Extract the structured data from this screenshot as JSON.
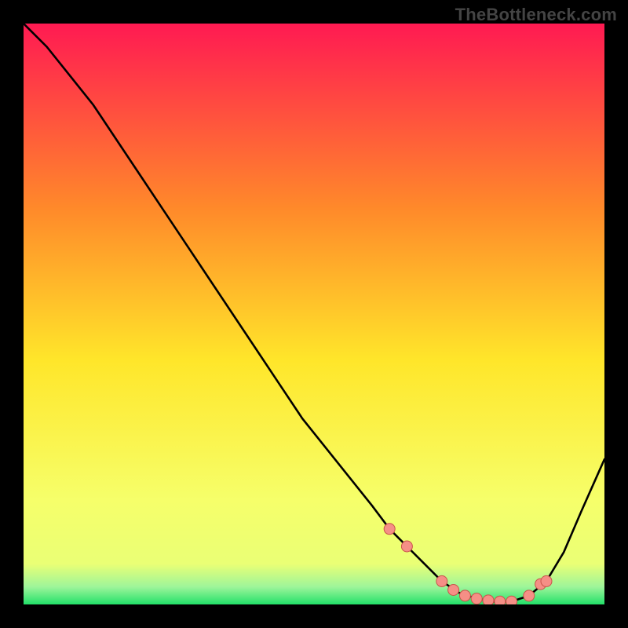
{
  "watermark": "TheBottleneck.com",
  "colors": {
    "bg_black": "#000000",
    "grad_top": "#ff1a52",
    "grad_mid_upper": "#ff8a2a",
    "grad_mid": "#ffe62a",
    "grad_lower": "#f6ff6a",
    "grad_green": "#22e069",
    "curve": "#000000",
    "marker_fill": "#f58f86",
    "marker_stroke": "#c9544a"
  },
  "chart_data": {
    "type": "line",
    "title": "",
    "xlabel": "",
    "ylabel": "",
    "xlim": [
      0,
      100
    ],
    "ylim": [
      0,
      100
    ],
    "note": "x is relative horizontal position (% of plot width), y is bottleneck-like metric (% height). Curve starts at 100 at x=0, drops roughly linearly to ~0 near x≈75–82, then rises to ~25 at x=100. Salmon markers sit near the trough.",
    "series": [
      {
        "name": "curve",
        "x": [
          0,
          4,
          8,
          12,
          16,
          20,
          24,
          28,
          32,
          36,
          40,
          44,
          48,
          52,
          56,
          60,
          63,
          66,
          69,
          72,
          75,
          78,
          81,
          84,
          87,
          90,
          93,
          96,
          100
        ],
        "y": [
          100,
          96,
          91,
          86,
          80,
          74,
          68,
          62,
          56,
          50,
          44,
          38,
          32,
          27,
          22,
          17,
          13,
          10,
          7,
          4,
          2,
          1,
          0.5,
          0.5,
          1.5,
          4,
          9,
          16,
          25
        ]
      }
    ],
    "markers": {
      "name": "highlight-points",
      "x": [
        63,
        66,
        72,
        74,
        76,
        78,
        80,
        82,
        84,
        87,
        89,
        90
      ],
      "y": [
        13,
        10,
        4,
        2.5,
        1.5,
        1,
        0.7,
        0.5,
        0.5,
        1.5,
        3.5,
        4
      ]
    }
  }
}
